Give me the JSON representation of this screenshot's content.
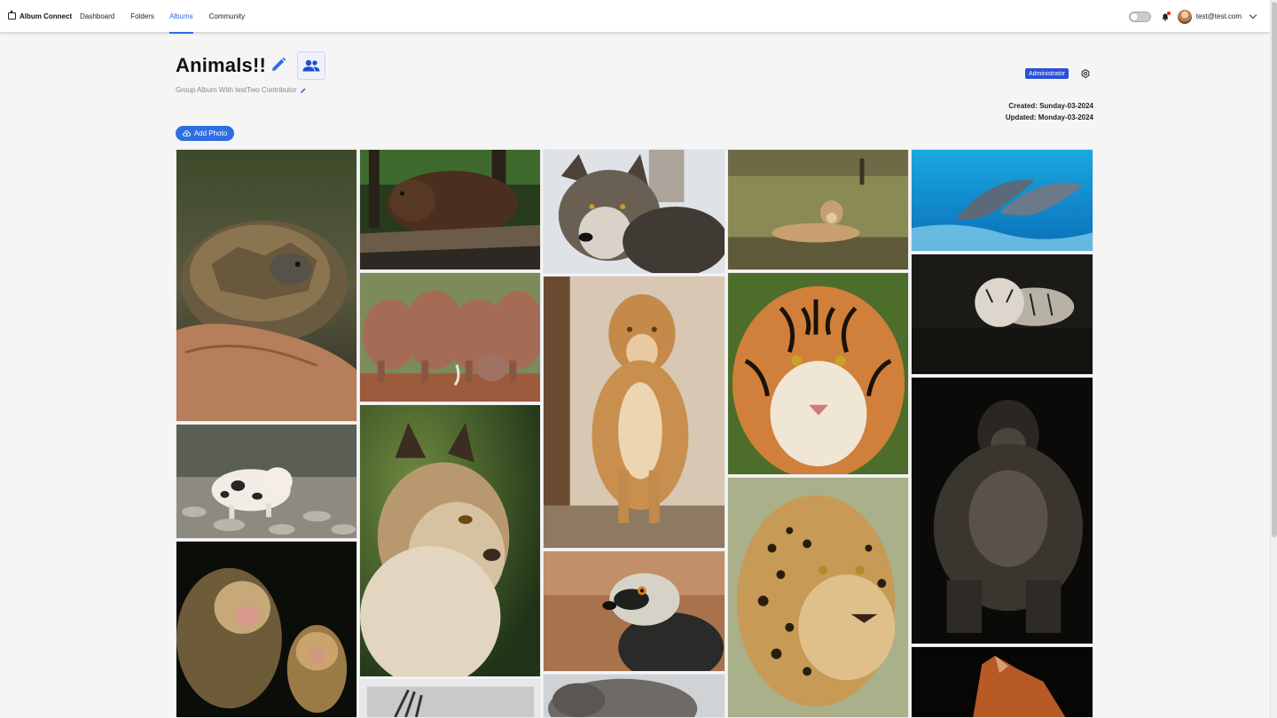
{
  "nav": {
    "brand": "Album Connect",
    "links": [
      {
        "label": "Dashboard",
        "active": false
      },
      {
        "label": "Folders",
        "active": false
      },
      {
        "label": "Albums",
        "active": true
      },
      {
        "label": "Community",
        "active": false
      }
    ],
    "user_email": "test@test.com",
    "theme_toggle": "off",
    "notification_dot": true
  },
  "album": {
    "title": "Animals!!",
    "subtitle": "Group Album With testTwo Contributor",
    "role_badge": "Administrator",
    "created": "Created: Sunday-03-2024",
    "updated": "Updated: Monday-03-2024",
    "add_photo_label": "Add Photo"
  },
  "colors": {
    "accent": "#2f6ee0",
    "badge": "#2b4fd6",
    "active_nav": "#2b6de0"
  },
  "photos": [
    {
      "subject": "tortoise"
    },
    {
      "subject": "piglet"
    },
    {
      "subject": "monkeys"
    },
    {
      "subject": "bear"
    },
    {
      "subject": "elephants"
    },
    {
      "subject": "lynx"
    },
    {
      "subject": "zebra"
    },
    {
      "subject": "wolf"
    },
    {
      "subject": "lioness-standing"
    },
    {
      "subject": "lemur"
    },
    {
      "subject": "elephant"
    },
    {
      "subject": "lioness-lying"
    },
    {
      "subject": "tiger"
    },
    {
      "subject": "leopard"
    },
    {
      "subject": "dolphins"
    },
    {
      "subject": "white-tiger"
    },
    {
      "subject": "gorilla"
    },
    {
      "subject": "horse"
    }
  ]
}
